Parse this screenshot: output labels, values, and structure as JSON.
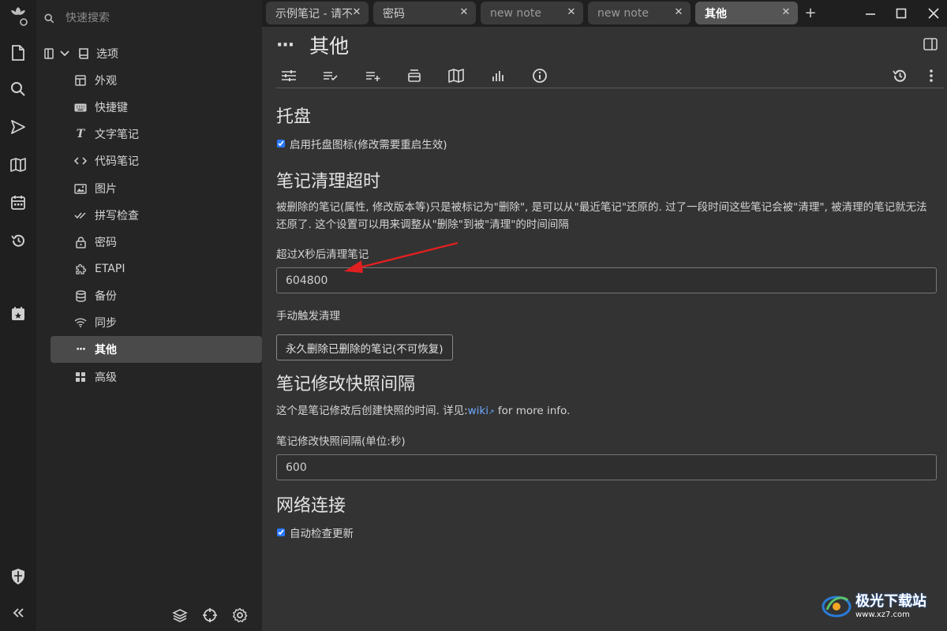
{
  "search": {
    "placeholder": "快速搜索"
  },
  "tree": {
    "root_label": "选项",
    "items": [
      {
        "label": "外观",
        "icon": "layout-icon"
      },
      {
        "label": "快捷键",
        "icon": "keyboard-icon"
      },
      {
        "label": "文字笔记",
        "icon": "text-icon"
      },
      {
        "label": "代码笔记",
        "icon": "code-icon"
      },
      {
        "label": "图片",
        "icon": "image-icon"
      },
      {
        "label": "拼写检查",
        "icon": "check-double-icon"
      },
      {
        "label": "密码",
        "icon": "lock-icon"
      },
      {
        "label": "ETAPI",
        "icon": "puzzle-icon"
      },
      {
        "label": "备份",
        "icon": "database-icon"
      },
      {
        "label": "同步",
        "icon": "wifi-icon"
      },
      {
        "label": "其他",
        "icon": "dots-icon",
        "active": true
      },
      {
        "label": "高级",
        "icon": "grid-icon"
      }
    ]
  },
  "tabs": [
    {
      "label": "示例笔记 - 请不",
      "active": false
    },
    {
      "label": "密码",
      "active": false
    },
    {
      "label": "new note",
      "active": false
    },
    {
      "label": "new note",
      "active": false
    },
    {
      "label": "其他",
      "active": true
    }
  ],
  "note": {
    "dots": "···",
    "title": "其他"
  },
  "sections": {
    "tray_heading": "托盘",
    "tray_checkbox": "启用托盘图标(修改需要重启生效)",
    "erase_heading": "笔记清理超时",
    "erase_desc": "被删除的笔记(属性, 修改版本等)只是被标记为\"删除\", 是可以从\"最近笔记\"还原的. 过了一段时间这些笔记会被\"清理\", 被清理的笔记就无法还原了. 这个设置可以用来调整从\"删除\"到被\"清理\"的时间间隔",
    "erase_label": "超过X秒后清理笔记",
    "erase_value": "604800",
    "manual_label": "手动触发清理",
    "manual_button": "永久删除已删除的笔记(不可恢复)",
    "revision_heading": "笔记修改快照间隔",
    "revision_desc_prefix": "这个是笔记修改后创建快照的时间. 详见:",
    "revision_link": "wiki",
    "revision_desc_suffix": " for more info.",
    "revision_label": "笔记修改快照间隔(单位:秒)",
    "revision_value": "600",
    "network_heading": "网络连接",
    "network_checkbox": "自动检查更新"
  },
  "watermark": {
    "text": "极光下载站",
    "url": "www.xz7.com"
  },
  "colors": {
    "accent": "#2979ff",
    "link": "#6ea8ff",
    "annotation_arrow": "#e02020"
  }
}
